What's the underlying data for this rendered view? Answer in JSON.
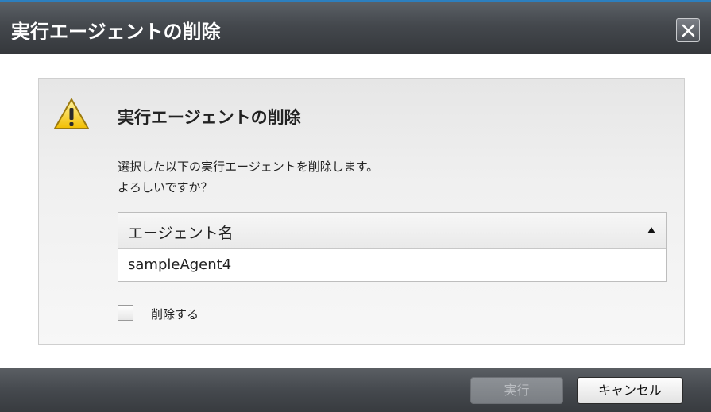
{
  "dialog": {
    "title": "実行エージェントの削除",
    "close_icon": "close-icon"
  },
  "panel": {
    "icon": "warning-icon",
    "heading": "実行エージェントの削除",
    "message_line1": "選択した以下の実行エージェントを削除します。",
    "message_line2": "よろしいですか？"
  },
  "table": {
    "column_header": "エージェント名",
    "sort_icon": "sort-ascending-icon",
    "rows": [
      {
        "name": "sampleAgent4"
      }
    ]
  },
  "checkbox": {
    "label": "削除する",
    "checked": false
  },
  "footer": {
    "execute_label": "実行",
    "execute_enabled": false,
    "cancel_label": "キャンセル"
  },
  "colors": {
    "titlebar": "#44484d",
    "accent": "#2c7fbf",
    "warning": "#f5c400"
  }
}
